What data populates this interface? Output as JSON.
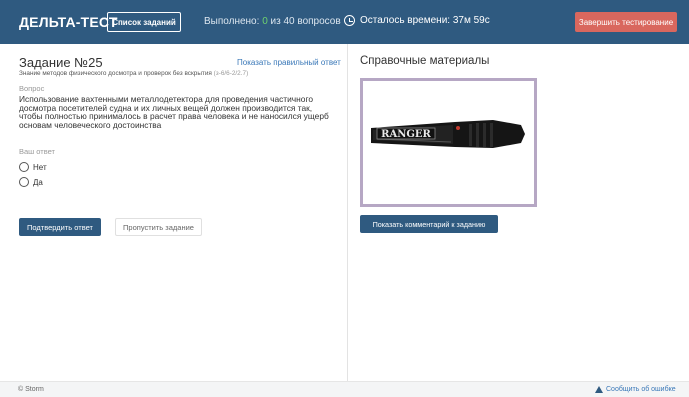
{
  "header": {
    "logo": "ДЕЛЬТА-ТЕСТ",
    "task_list_label": "Список заданий",
    "progress_prefix": "Выполнено: ",
    "progress_done": "0",
    "progress_suffix": " из 40 вопросов",
    "timer_text": "Осталось времени: 37м 59с",
    "finish_label": "Завершить тестирование"
  },
  "task": {
    "title": "Задание №25",
    "show_answer_label": "Показать правильный ответ",
    "topic": "Знание методов физического досмотра и проверок без вскрытия ",
    "topic_code": "(з-6/6-2/2.7)",
    "question_label": "Вопрос",
    "question_text": "Использование вахтенными металлодетектора для проведения частичного досмотра посетителей судна и их личных вещей должен производится так, чтобы полностью принималось в расчет права человека и не наносился ущерб основам человеческого достоинства",
    "answer_label": "Ваш ответ",
    "options": [
      "Нет",
      "Да"
    ],
    "confirm_label": "Подтвердить ответ",
    "skip_label": "Пропустить задание"
  },
  "reference": {
    "title": "Справочные материалы",
    "image_brand": "RANGER",
    "comment_label": "Показать комментарий к заданию"
  },
  "footer": {
    "copyright": "© Storm",
    "report_label": "Сообщить об ошибке"
  },
  "colors": {
    "header_bg": "#2f5a80",
    "finish_bg": "#d9675e",
    "done_count": "#6fd26f",
    "link": "#3a78b8"
  }
}
